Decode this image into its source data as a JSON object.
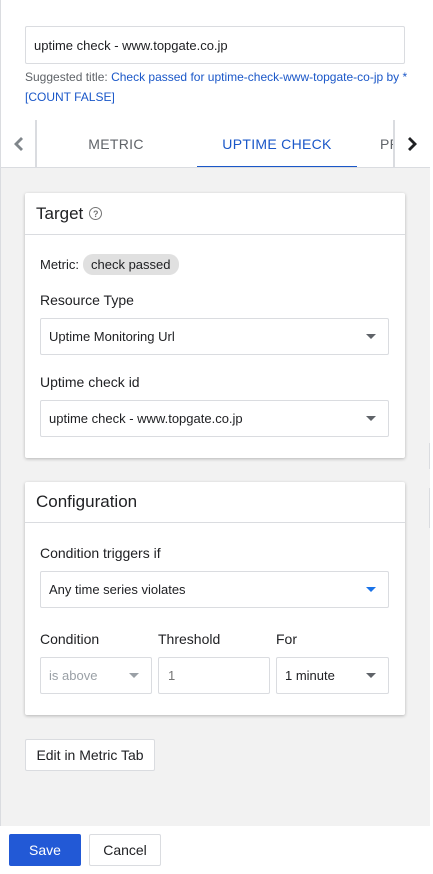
{
  "title_input": {
    "value": "uptime check - www.topgate.co.jp"
  },
  "suggestion": {
    "prefix": "Suggested title: ",
    "link": "Check passed for uptime-check-www-topgate-co-jp by * [COUNT FALSE]"
  },
  "tabs": [
    {
      "label": "METRIC"
    },
    {
      "label": "UPTIME CHECK"
    },
    {
      "label": "PR"
    }
  ],
  "target": {
    "heading": "Target",
    "help_icon": "?",
    "metric_label": "Metric:",
    "metric_chip": "check passed",
    "resource_type_label": "Resource Type",
    "resource_type_value": "Uptime Monitoring Url",
    "uptime_id_label": "Uptime check id",
    "uptime_id_value": "uptime check - www.topgate.co.jp"
  },
  "configuration": {
    "heading": "Configuration",
    "trigger_label": "Condition triggers if",
    "trigger_value": "Any time series violates",
    "condition_label": "Condition",
    "condition_value": "is above",
    "threshold_label": "Threshold",
    "threshold_placeholder": "1",
    "for_label": "For",
    "for_value": "1 minute"
  },
  "edit_button": "Edit in Metric Tab",
  "footer": {
    "save": "Save",
    "cancel": "Cancel"
  },
  "colors": {
    "accent": "#1a57c8",
    "primary_button": "#2259d6"
  },
  "icons": [
    "chevron-left-icon",
    "chevron-right-icon",
    "help-icon",
    "dropdown-caret-icon"
  ]
}
